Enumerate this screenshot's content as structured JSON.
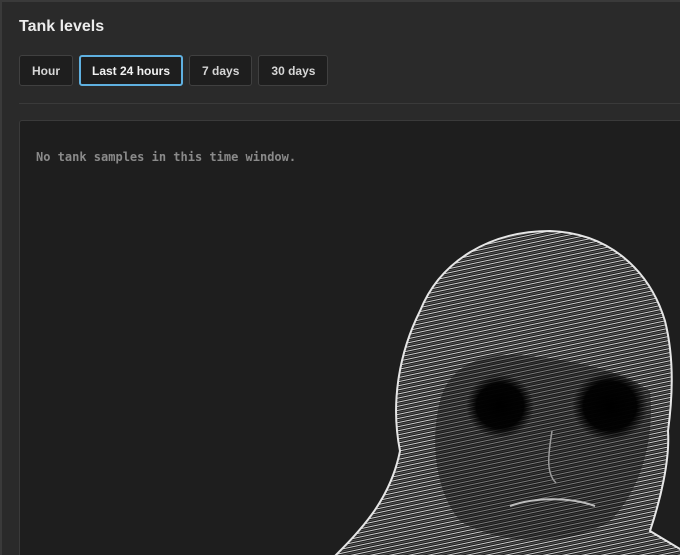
{
  "header": {
    "title": "Tank levels"
  },
  "time_ranges": [
    {
      "label": "Hour",
      "active": false
    },
    {
      "label": "Last 24 hours",
      "active": true
    },
    {
      "label": "7 days",
      "active": false
    },
    {
      "label": "30 days",
      "active": false
    }
  ],
  "panel": {
    "empty_message": "No tank samples in this time window."
  },
  "colors": {
    "background": "#2a2a2a",
    "panel": "#1e1e1e",
    "active_border": "#5fb0e0"
  }
}
